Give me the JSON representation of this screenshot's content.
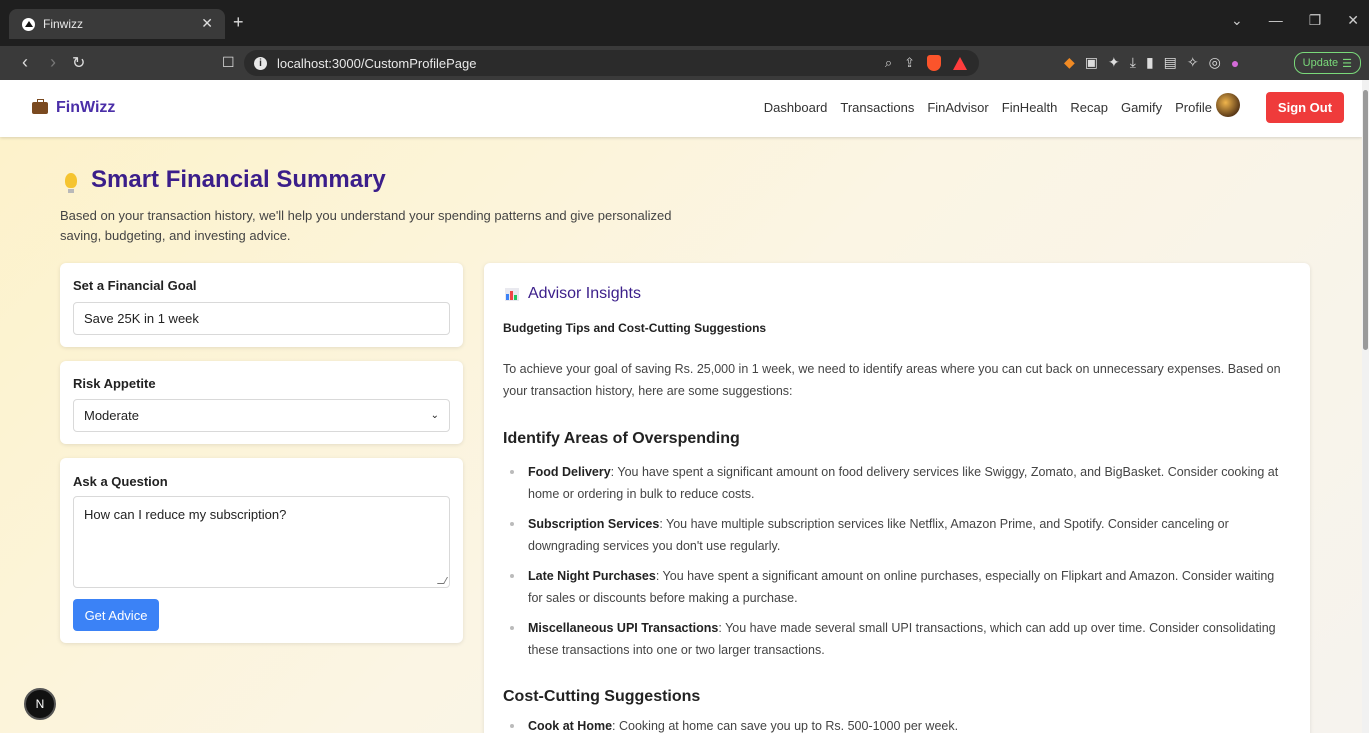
{
  "browser": {
    "tab_title": "Finwizz",
    "url": "localhost:3000/CustomProfilePage",
    "update_label": "Update"
  },
  "nav": {
    "brand": "FinWizz",
    "items": [
      "Dashboard",
      "Transactions",
      "FinAdvisor",
      "FinHealth",
      "Recap",
      "Gamify",
      "Profile"
    ],
    "signout_label": "Sign Out"
  },
  "hero": {
    "title": "Smart Financial Summary",
    "intro": "Based on your transaction history, we'll help you understand your spending patterns and give personalized saving, budgeting, and investing advice."
  },
  "goal": {
    "label": "Set a Financial Goal",
    "value": "Save 25K in 1 week"
  },
  "risk": {
    "label": "Risk Appetite",
    "selected": "Moderate"
  },
  "question": {
    "label": "Ask a Question",
    "value": "How can I reduce my subscription?",
    "button": "Get Advice"
  },
  "insights": {
    "heading": "Advisor Insights",
    "subheading": "Budgeting Tips and Cost-Cutting Suggestions",
    "paragraph": "To achieve your goal of saving Rs. 25,000 in 1 week, we need to identify areas where you can cut back on unnecessary expenses. Based on your transaction history, here are some suggestions:",
    "section1_title": "Identify Areas of Overspending",
    "overspending": [
      {
        "term": "Food Delivery",
        "text": ": You have spent a significant amount on food delivery services like Swiggy, Zomato, and BigBasket. Consider cooking at home or ordering in bulk to reduce costs."
      },
      {
        "term": "Subscription Services",
        "text": ": You have multiple subscription services like Netflix, Amazon Prime, and Spotify. Consider canceling or downgrading services you don't use regularly."
      },
      {
        "term": "Late Night Purchases",
        "text": ": You have spent a significant amount on online purchases, especially on Flipkart and Amazon. Consider waiting for sales or discounts before making a purchase."
      },
      {
        "term": "Miscellaneous UPI Transactions",
        "text": ": You have made several small UPI transactions, which can add up over time. Consider consolidating these transactions into one or two larger transactions."
      }
    ],
    "section2_title": "Cost-Cutting Suggestions",
    "cost_cutting": [
      {
        "term": "Cook at Home",
        "text": ": Cooking at home can save you up to Rs. 500-1000 per week."
      }
    ]
  },
  "devtools_badge": "N"
}
